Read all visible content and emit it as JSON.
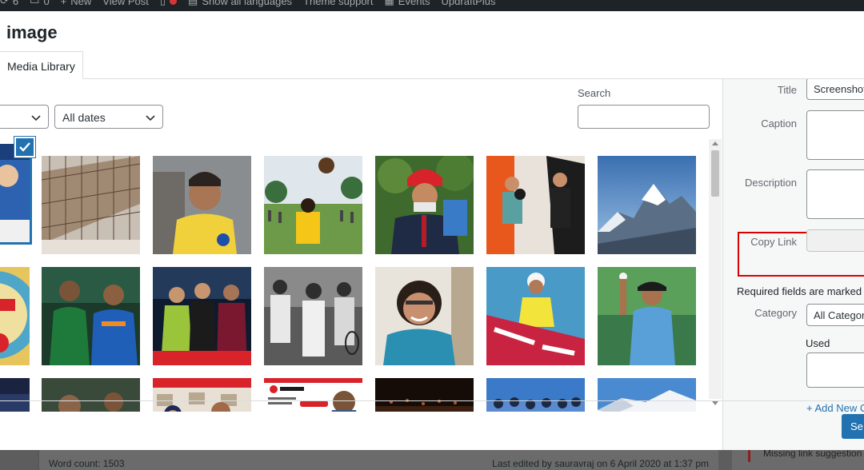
{
  "admin_bar": {
    "items": [
      {
        "icon": "updates-icon",
        "label": "6"
      },
      {
        "icon": "comments-icon",
        "label": "0"
      },
      {
        "icon": "plus-icon",
        "label": "New"
      },
      {
        "icon": "",
        "label": "View Post"
      },
      {
        "icon": "translate-icon",
        "label": "Show all languages"
      },
      {
        "icon": "",
        "label": "Theme support"
      },
      {
        "icon": "calendar-icon",
        "label": "Events"
      },
      {
        "icon": "",
        "label": "UpdraftPlus"
      }
    ]
  },
  "modal": {
    "title": "image",
    "tabs": [
      {
        "label": "Media Library"
      }
    ],
    "filters": {
      "type_value": "",
      "date_value": "All dates"
    },
    "search": {
      "label": "Search",
      "value": ""
    }
  },
  "sidebar": {
    "fields": {
      "title_label": "Title",
      "title_value": "Screenshot",
      "caption_label": "Caption",
      "description_label": "Description",
      "copy_link_label": "Copy Link"
    },
    "required_text": "Required fields are marked",
    "required_star": "*",
    "category_label": "Category",
    "category_value": "All Categor",
    "used_label": "Used",
    "add_new": "+ Add New C"
  },
  "footer": {
    "set_button": "Se"
  },
  "editor": {
    "word_count": "Word count: 1503",
    "last_edited": "Last edited by sauravraj on 6 April 2020 at 1:37 pm",
    "missing_link": "Missing link suggestion"
  },
  "colors": {
    "accent": "#2271b1",
    "highlight_box": "#d90000",
    "admin_bar": "#1d2327"
  }
}
